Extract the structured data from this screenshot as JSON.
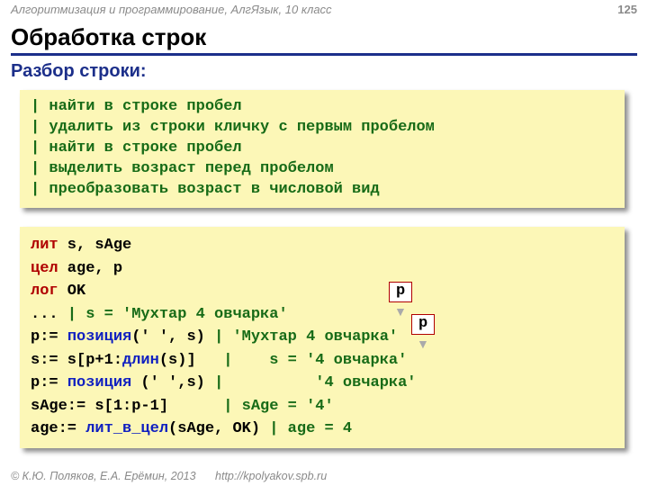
{
  "header": {
    "course": "Алгоритмизация и программирование, АлгЯзык, 10 класс",
    "page": "125"
  },
  "title": "Обработка строк",
  "subtitle": "Разбор строки:",
  "comments": [
    "| найти в строке пробел",
    "| удалить из строки кличку с первым пробелом",
    "| найти в строке пробел",
    "| выделить возраст перед пробелом",
    "| преобразовать возраст в числовой вид"
  ],
  "code": {
    "l1a": "лит",
    "l1b": " s, sAge",
    "l2a": "цел",
    "l2b": " age, p",
    "l3a": "лог",
    "l3b": " OK",
    "l4a": "... ",
    "l4b": "| s = 'Мухтар 4 овчарка'",
    "l5a": "p:= ",
    "l5b": "позиция",
    "l5c": "(' ', s) ",
    "l5d": "| 'Мухтар 4 овчарка'",
    "l6a": "s:= s[p+1:",
    "l6b": "длин",
    "l6c": "(s)]   ",
    "l6d": "|    s = '4 овчарка'",
    "l7a": "p:= ",
    "l7b": "позиция",
    "l7c": " (' ',s) ",
    "l7d": "|          '4 овчарка'",
    "l8a": "sAge:= s[1:p-1]      ",
    "l8b": "| sAge = '4'",
    "l9a": "age:= ",
    "l9b": "лит_в_цел",
    "l9c": "(sAge, OK) ",
    "l9d": "| age = 4"
  },
  "labels": {
    "p1": "p",
    "p2": "p"
  },
  "footer": {
    "copyright": "© К.Ю. Поляков, Е.А. Ерёмин, 2013",
    "url": "http://kpolyakov.spb.ru"
  }
}
